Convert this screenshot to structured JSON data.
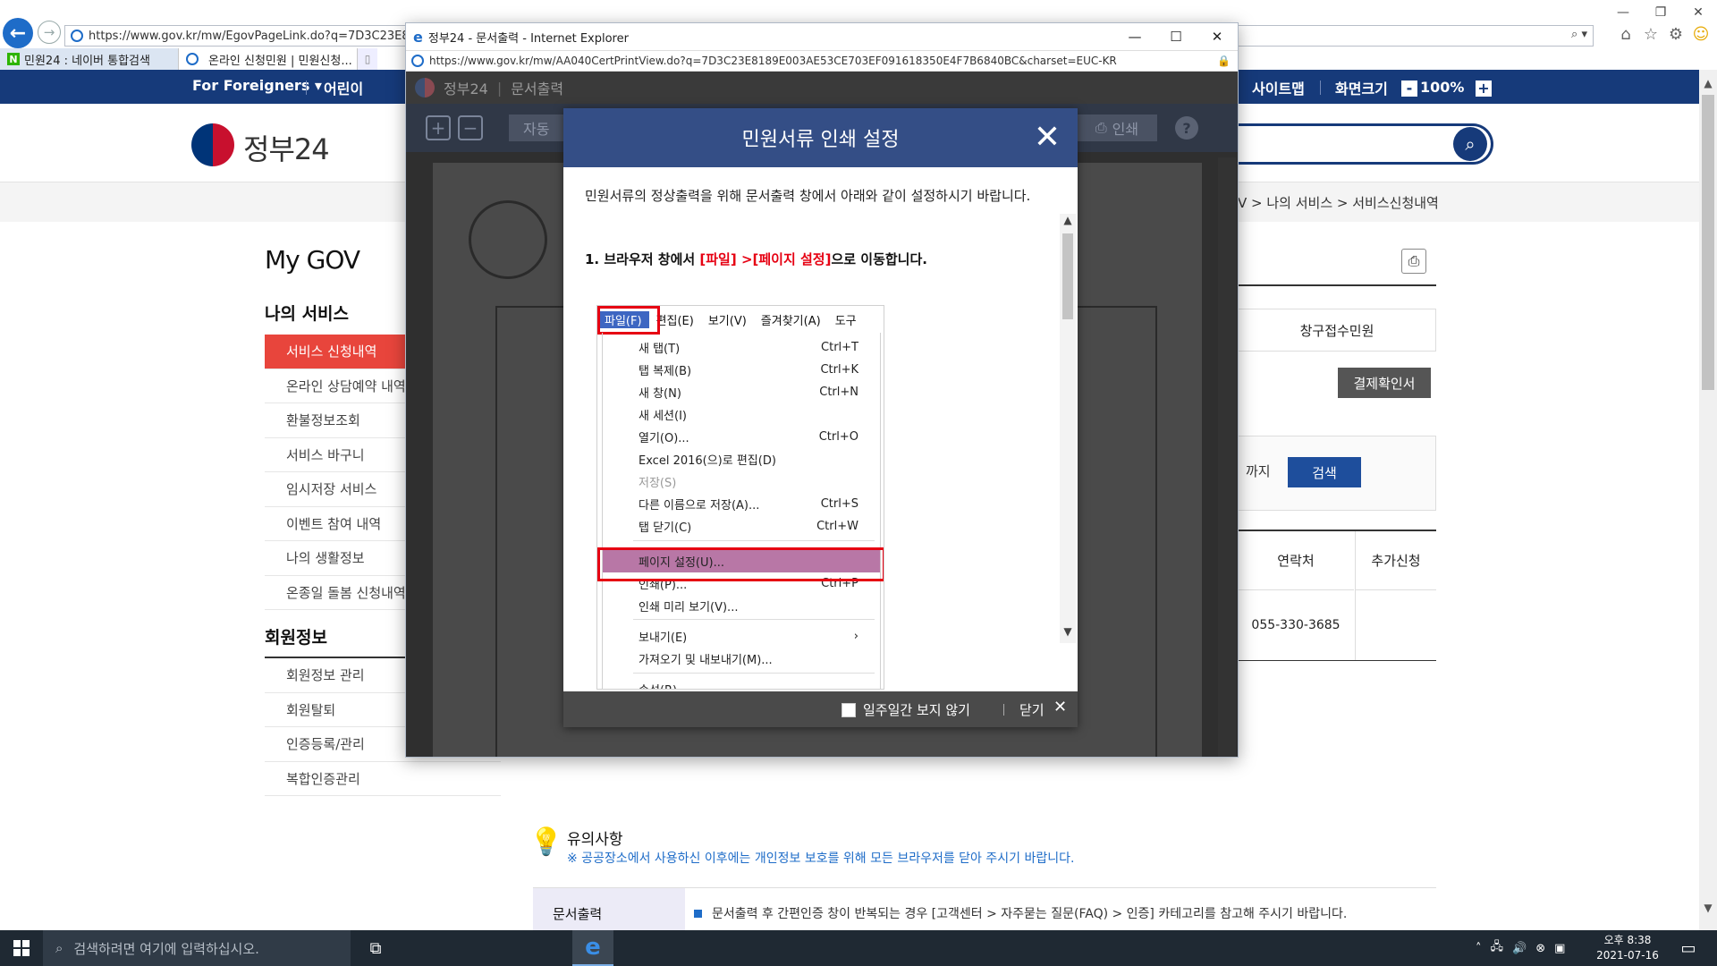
{
  "bg_browser": {
    "url": "https://www.gov.kr/mw/EgovPageLink.do?q=7D3C23E8189E003A",
    "tabs": [
      {
        "label": "민원24 : 네이버 통합검색"
      },
      {
        "label": "온라인 신청민원 | 민원신청...",
        "close": "×"
      }
    ],
    "toolbar_icons": [
      "home-icon",
      "favorites-star-icon",
      "settings-gear-icon",
      "smile-feedback-icon"
    ]
  },
  "site": {
    "topbar": {
      "for_foreigners": "For Foreigners ▾",
      "kids": "어린이",
      "sitemap": "사이트맵",
      "screen_size": "화면크기",
      "zoom_minus": "-",
      "zoom_value": "100%",
      "zoom_plus": "+"
    },
    "logo_text": "정부24",
    "breadcrumb": "V  >  나의 서비스  >  서비스신청내역",
    "mygov_title": "My GOV",
    "my_services_heading": "나의 서비스",
    "nav_items": [
      "서비스 신청내역",
      "온라인 상담예약 내역",
      "환불정보조회",
      "서비스 바구니",
      "임시저장 서비스",
      "이벤트 참여 내역",
      "나의 생활정보",
      "온종일 돌봄 신청내역"
    ],
    "member_heading": "회원정보",
    "member_items": [
      "회원정보 관리",
      "회원탈퇴",
      "인증등록/관리",
      "복합인증관리"
    ],
    "counter_label": "창구접수민원",
    "payment_button": "결제확인서",
    "until_label": "까지",
    "search_button": "검색",
    "table_headers": {
      "contact": "연락처",
      "additional": "추가신청"
    },
    "table_row": {
      "phone": "055-330-3685"
    },
    "notice_title": "유의사항",
    "notice_text": "※ 공공장소에서 사용하신 이후에는 개인정보 보호를 위해 모든 브라우저를 닫아 주시기 바랍니다.",
    "doc_print_label": "문서출력",
    "doc_print_text": "문서출력 후 간편인증 창이 반복되는 경우 [고객센터 > 자주묻는 질문(FAQ) > 인증] 카테고리를 참고해 주시기 바랍니다."
  },
  "popup": {
    "title": "정부24 - 문서출력 - Internet Explorer",
    "url": "https://www.gov.kr/mw/AA040CertPrintView.do?q=7D3C23E8189E003AE53CE703EF091618350E4F7B6840BC&charset=EUC-KR",
    "viewer_brand": "정부24",
    "viewer_section": "문서출력",
    "zoom_mode": "자동",
    "print_label": "인쇄",
    "help": "?"
  },
  "modal": {
    "title": "민원서류 인쇄 설정",
    "intro": "민원서류의 정상출력을 위해 문서출력 창에서 아래와 같이 설정하시기 바랍니다.",
    "step1_prefix": "1. 브라우저 창에서 ",
    "step1_highlight": "[파일] >[페이지 설정]",
    "step1_suffix": "으로 이동합니다.",
    "menubar": [
      "파일(F)",
      "편집(E)",
      "보기(V)",
      "즐겨찾기(A)",
      "도구"
    ],
    "file_menu": [
      {
        "label": "새 탭(T)",
        "shortcut": "Ctrl+T"
      },
      {
        "label": "탭 복제(B)",
        "shortcut": "Ctrl+K"
      },
      {
        "label": "새 창(N)",
        "shortcut": "Ctrl+N"
      },
      {
        "label": "새 세션(I)",
        "shortcut": ""
      },
      {
        "label": "열기(O)...",
        "shortcut": "Ctrl+O"
      },
      {
        "label": "Excel 2016(으)로 편집(D)",
        "shortcut": ""
      },
      {
        "label": "저장(S)",
        "shortcut": ""
      },
      {
        "label": "다른 이름으로 저장(A)...",
        "shortcut": "Ctrl+S"
      },
      {
        "label": "탭 닫기(C)",
        "shortcut": "Ctrl+W"
      },
      {
        "label": "페이지 설정(U)...",
        "shortcut": ""
      },
      {
        "label": "인쇄(P)...",
        "shortcut": "Ctrl+P"
      },
      {
        "label": "인쇄 미리 보기(V)...",
        "shortcut": ""
      },
      {
        "label": "보내기(E)",
        "shortcut": "›"
      },
      {
        "label": "가져오기 및 내보내기(M)...",
        "shortcut": ""
      },
      {
        "label": "속성(R)",
        "shortcut": ""
      }
    ],
    "dont_show_week": "일주일간 보지 않기",
    "close_label": "닫기"
  },
  "taskbar": {
    "search_placeholder": "검색하려면 여기에 입력하십시오.",
    "time": "오후 8:38",
    "date": "2021-07-16"
  },
  "colors": {
    "gov_navy": "#163a7a",
    "modal_header": "#344e86",
    "highlight_red": "#e60012",
    "active_nav": "#e8453c",
    "menu_highlight": "#b877a6"
  }
}
